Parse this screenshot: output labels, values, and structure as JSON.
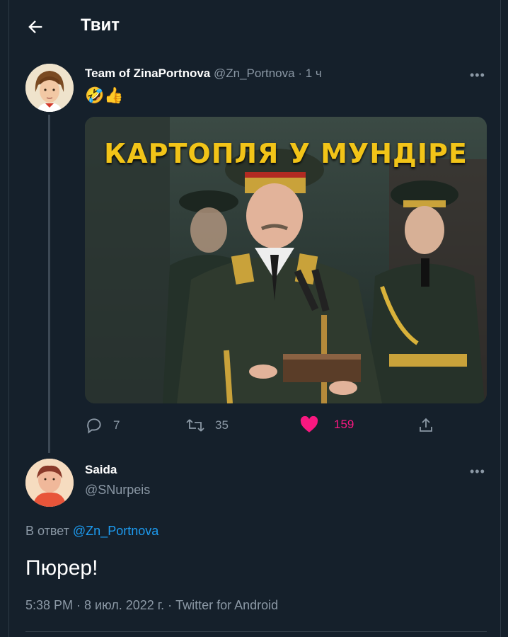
{
  "header": {
    "title": "Твит",
    "back_icon": "arrow-left-icon"
  },
  "tweet": {
    "author_name": "Team of ZinaPortnova",
    "author_handle": "@Zn_Portnova",
    "time": "· 1 ч",
    "text_emojis": "🤣👍",
    "media": {
      "caption": "КАРТОПЛЯ У МУНДІРЕ"
    },
    "stats": {
      "replies": "7",
      "retweets": "35",
      "likes": "159"
    },
    "more_icon": "more-horizontal-icon"
  },
  "reply": {
    "author_name": "Saida",
    "author_handle": "@SNurpeis",
    "replying_prefix": "В ответ",
    "replying_to": "@Zn_Portnova",
    "text": "Пюрер!",
    "meta": "5:38 PM · 8 июл. 2022 г. · Twitter for Android"
  },
  "colors": {
    "background": "#15202b",
    "muted": "#8b98a5",
    "link": "#1d9bf0",
    "like": "#f91880",
    "caption": "#f2c418"
  }
}
